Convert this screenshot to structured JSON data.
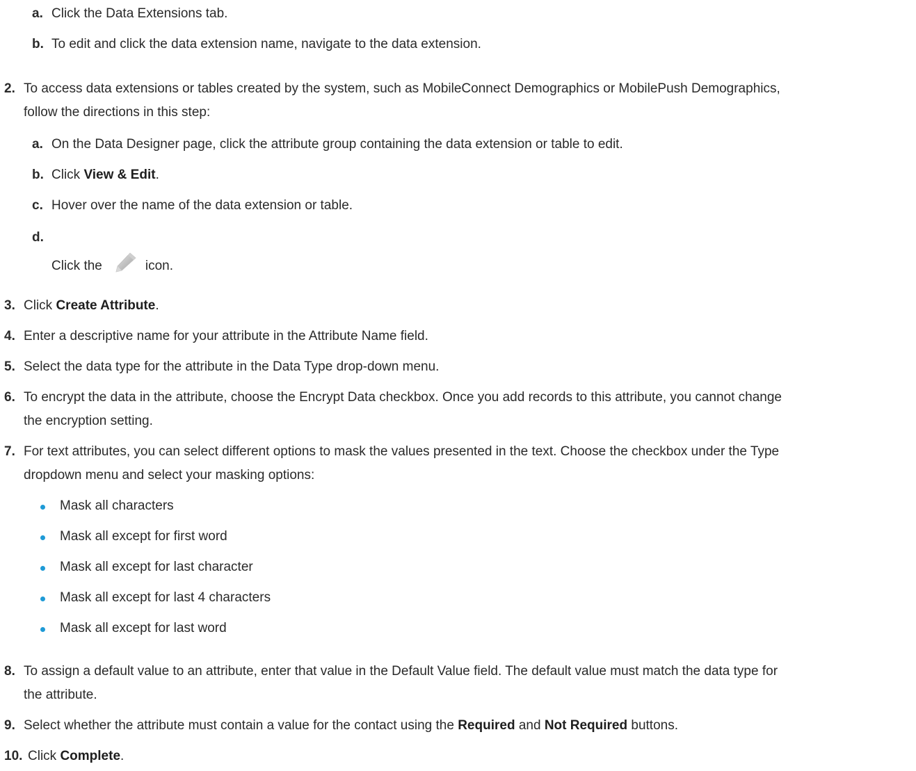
{
  "steps": {
    "s1a_marker": "a.",
    "s1a_text": "Click the Data Extensions tab.",
    "s1b_marker": "b.",
    "s1b_text": "To edit and click the data extension name, navigate to the data extension.",
    "s2_marker": "2.",
    "s2_text_line1": "To access data extensions or tables created by the system, such as MobileConnect Demographics or MobilePush Demographics,",
    "s2_text_line2": "follow the directions in this step:",
    "s2a_marker": "a.",
    "s2a_text": "On the Data Designer page, click the attribute group containing the data extension or table to edit.",
    "s2b_marker": "b.",
    "s2b_pre": "Click ",
    "s2b_bold": "View & Edit",
    "s2b_post": ".",
    "s2c_marker": "c.",
    "s2c_text": "Hover over the name of the data extension or table.",
    "s2d_marker": "d.",
    "s2d_pre": "Click the",
    "s2d_icon": "pencil-icon",
    "s2d_post": "icon.",
    "s3_marker": "3.",
    "s3_pre": "Click ",
    "s3_bold": "Create Attribute",
    "s3_post": ".",
    "s4_marker": "4.",
    "s4_text": "Enter a descriptive name for your attribute in the Attribute Name field.",
    "s5_marker": "5.",
    "s5_text": "Select the data type for the attribute in the Data Type drop-down menu.",
    "s6_marker": "6.",
    "s6_text_line1": "To encrypt the data in the attribute, choose the Encrypt Data checkbox. Once you add records to this attribute, you cannot change",
    "s6_text_line2": "the encryption setting.",
    "s7_marker": "7.",
    "s7_text_line1": "For text attributes, you can select different options to mask the values presented in the text. Choose the checkbox under the Type",
    "s7_text_line2": "dropdown menu and select your masking options:",
    "s7_options": [
      "Mask all characters",
      "Mask all except for first word",
      "Mask all except for last character",
      "Mask all except for last 4 characters",
      "Mask all except for last word"
    ],
    "s8_marker": "8.",
    "s8_text_line1": "To assign a default value to an attribute, enter that value in the Default Value field. The default value must match the data type for",
    "s8_text_line2": "the attribute.",
    "s9_marker": "9.",
    "s9_pre": "Select whether the attribute must contain a value for the contact using the ",
    "s9_bold1": "Required",
    "s9_mid": " and ",
    "s9_bold2": "Not Required",
    "s9_post": " buttons.",
    "s10_marker": "10.",
    "s10_pre": "Click ",
    "s10_bold": "Complete",
    "s10_post": "."
  },
  "colors": {
    "bullet": "#1e9ad6",
    "text": "#2a2a2a"
  }
}
